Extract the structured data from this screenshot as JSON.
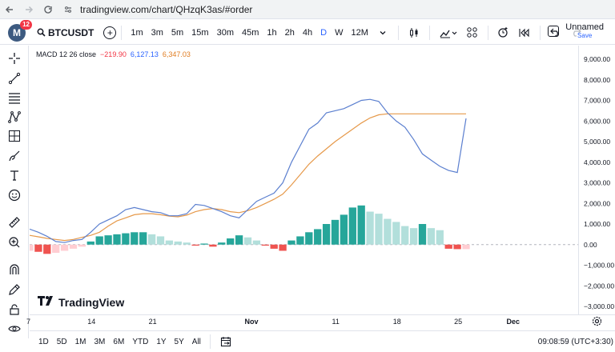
{
  "browser": {
    "url": "tradingview.com/chart/QHzqK3as/#order"
  },
  "toolbar": {
    "avatar_letter": "M",
    "avatar_badge": "12",
    "symbol": "BTCUSDT",
    "add_symbol_glyph": "+",
    "intervals": [
      "1m",
      "3m",
      "5m",
      "15m",
      "30m",
      "45m",
      "1h",
      "2h",
      "4h",
      "D",
      "W",
      "12M"
    ],
    "active_interval": "D",
    "layout_name": "Unnamed",
    "save_label": "Save"
  },
  "legend": {
    "name": "MACD 12 26 close",
    "histogram": "−219.90",
    "macd": "6,127.13",
    "signal": "6,347.03"
  },
  "watermark": "TradingView",
  "bottom": {
    "ranges": [
      "1D",
      "5D",
      "1M",
      "3M",
      "6M",
      "YTD",
      "1Y",
      "5Y",
      "All"
    ],
    "clock": "09:08:59 (UTC+3:30)"
  },
  "colors": {
    "macd_line": "#5b7fcf",
    "signal_line": "#e6994a",
    "hist_pos_strong": "#26a69a",
    "hist_pos_weak": "#b2dfdb",
    "hist_neg_strong": "#ef5350",
    "hist_neg_weak": "#ffcdd2",
    "accent": "#2962ff"
  },
  "icons": {
    "back": "arrow-left-icon",
    "forward": "arrow-right-icon",
    "reload": "reload-icon",
    "site_info": "site-info-icon"
  },
  "chart_data": {
    "type": "line",
    "title": "MACD 12 26 close",
    "x": [
      "7",
      "8",
      "9",
      "10",
      "11",
      "12",
      "13",
      "14",
      "15",
      "16",
      "17",
      "18",
      "19",
      "20",
      "21",
      "22",
      "23",
      "24",
      "25",
      "26",
      "27",
      "28",
      "29",
      "30",
      "31",
      "Nov",
      "2",
      "3",
      "4",
      "5",
      "6",
      "7",
      "8",
      "9",
      "10",
      "11",
      "12",
      "13",
      "14",
      "15",
      "16",
      "17",
      "18",
      "19",
      "20",
      "21",
      "22",
      "23",
      "24",
      "25",
      "26"
    ],
    "x_tick_labels": [
      "7",
      "14",
      "21",
      "Nov",
      "11",
      "18",
      "25",
      "Dec"
    ],
    "y_tick_labels": [
      "9,000.00",
      "8,000.00",
      "7,000.00",
      "6,000.00",
      "5,000.00",
      "4,000.00",
      "3,000.00",
      "2,000.00",
      "1,000.00",
      "0.00",
      "−1,000.00",
      "−2,000.00",
      "−3,000.00"
    ],
    "ylim": [
      -3000,
      9000
    ],
    "series": [
      {
        "name": "MACD",
        "values": [
          750,
          600,
          400,
          150,
          100,
          200,
          250,
          600,
          1000,
          1200,
          1400,
          1700,
          1800,
          1700,
          1600,
          1550,
          1400,
          1400,
          1500,
          1950,
          1900,
          1750,
          1600,
          1400,
          1300,
          1700,
          2100,
          2300,
          2500,
          3000,
          4000,
          4800,
          5600,
          5900,
          6400,
          6500,
          6600,
          6800,
          7000,
          7050,
          6950,
          6400,
          6000,
          5700,
          5100,
          4400,
          4100,
          3800,
          3600,
          3500,
          6127
        ]
      },
      {
        "name": "Signal",
        "values": [
          450,
          380,
          300,
          250,
          200,
          250,
          350,
          450,
          600,
          900,
          1150,
          1300,
          1450,
          1500,
          1500,
          1450,
          1380,
          1350,
          1430,
          1600,
          1700,
          1750,
          1700,
          1600,
          1550,
          1650,
          1800,
          2000,
          2200,
          2450,
          2900,
          3400,
          3900,
          4300,
          4650,
          5000,
          5300,
          5600,
          5900,
          6150,
          6300,
          6347,
          6347,
          6347,
          6347,
          6347,
          6347,
          6347,
          6347,
          6347,
          6347
        ]
      },
      {
        "name": "Histogram",
        "values": [
          -300,
          -350,
          -450,
          -400,
          -300,
          -200,
          -100,
          150,
          400,
          450,
          500,
          550,
          600,
          600,
          500,
          400,
          200,
          150,
          100,
          -50,
          50,
          -100,
          100,
          300,
          450,
          350,
          200,
          -50,
          -200,
          -300,
          200,
          400,
          600,
          750,
          1000,
          1200,
          1450,
          1800,
          1900,
          1600,
          1500,
          1250,
          1100,
          900,
          800,
          1000,
          800,
          700,
          -200,
          -220,
          -219.9
        ]
      }
    ]
  }
}
